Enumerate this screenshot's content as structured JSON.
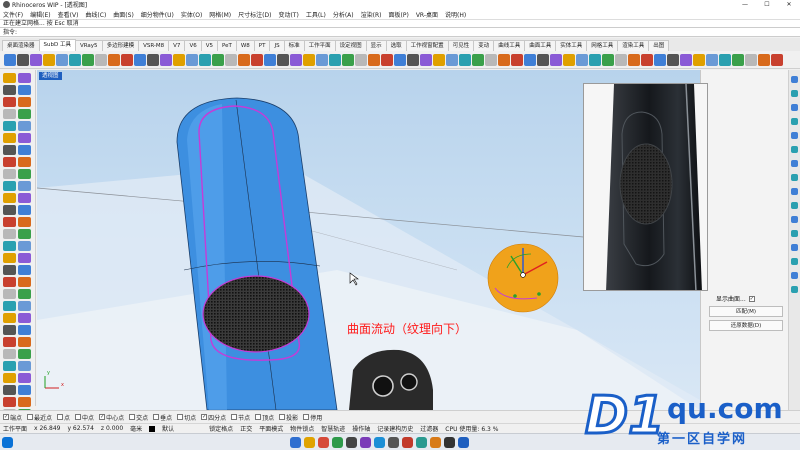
{
  "window": {
    "title": "Rhinoceros WIP - [透视图]",
    "min": "—",
    "max": "☐",
    "close": "✕"
  },
  "menu": [
    "文件(F)",
    "编辑(E)",
    "查看(V)",
    "曲线(C)",
    "曲面(S)",
    "细分物件(U)",
    "实体(O)",
    "网格(M)",
    "尺寸标注(D)",
    "变动(T)",
    "工具(L)",
    "分析(A)",
    "渲染(R)",
    "面板(P)",
    "VR-桌面",
    "说明(H)"
  ],
  "command": {
    "history": "正在建立网格... 按 Esc 取消",
    "prompt": "指令:"
  },
  "tabs": [
    "标准",
    "工作平面",
    "设定视图",
    "显示",
    "选取",
    "工作视窗配置",
    "可见性",
    "变动",
    "曲线工具",
    "曲面工具",
    "实体工具",
    "网格工具",
    "渲染工具",
    "出图"
  ],
  "plugin_tabs": [
    "桌面渲染器",
    "SubD 工具",
    "VRay5",
    "多边形建模",
    "VSR-M8",
    "V7",
    "V6",
    "V5",
    "PeT",
    "W8",
    "PT",
    "JS"
  ],
  "active_plugin_tab": 1,
  "viewport": {
    "label": "透视图",
    "annotation": "曲面流动（纹理向下）",
    "axis_x": "x",
    "axis_y": "y"
  },
  "right_panel": {
    "checkbox_label": "显示曲面...",
    "buttons": [
      "匹配(M)",
      "还原数据(D)"
    ]
  },
  "osnaps": [
    {
      "label": "端点",
      "checked": true
    },
    {
      "label": "最近点",
      "checked": false
    },
    {
      "label": "点",
      "checked": false
    },
    {
      "label": "中点",
      "checked": false
    },
    {
      "label": "中心点",
      "checked": true
    },
    {
      "label": "交点",
      "checked": false
    },
    {
      "label": "垂点",
      "checked": false
    },
    {
      "label": "切点",
      "checked": false
    },
    {
      "label": "四分点",
      "checked": true
    },
    {
      "label": "节点",
      "checked": false
    },
    {
      "label": "顶点",
      "checked": false
    },
    {
      "label": "投影",
      "checked": false
    },
    {
      "label": "停用",
      "checked": false
    }
  ],
  "status": {
    "plane": "工作平面",
    "x": "x 26.849",
    "y": "y 62.574",
    "z": "z 0.000",
    "unit": "毫米",
    "layer": "默认",
    "lock_grid": "锁定格点",
    "ortho": "正交",
    "planar": "平面模式",
    "osnap": "物件锁点",
    "smarttrack": "智慧轨迹",
    "gumball": "操作轴",
    "record": "记录建构历史",
    "filter": "过滤器",
    "cpu": "CPU 使用量: 6.3 %"
  },
  "watermark": {
    "brand": "D1",
    "domain": "qu.com",
    "slogan": "第一区自学网"
  },
  "colors": {
    "accent": "#1f5fbf",
    "surface": "#3d8fe0",
    "grille": "#222222",
    "seam": "#c53bd8",
    "disc": "#f0a21b",
    "annotation": "#ff1a1a"
  }
}
